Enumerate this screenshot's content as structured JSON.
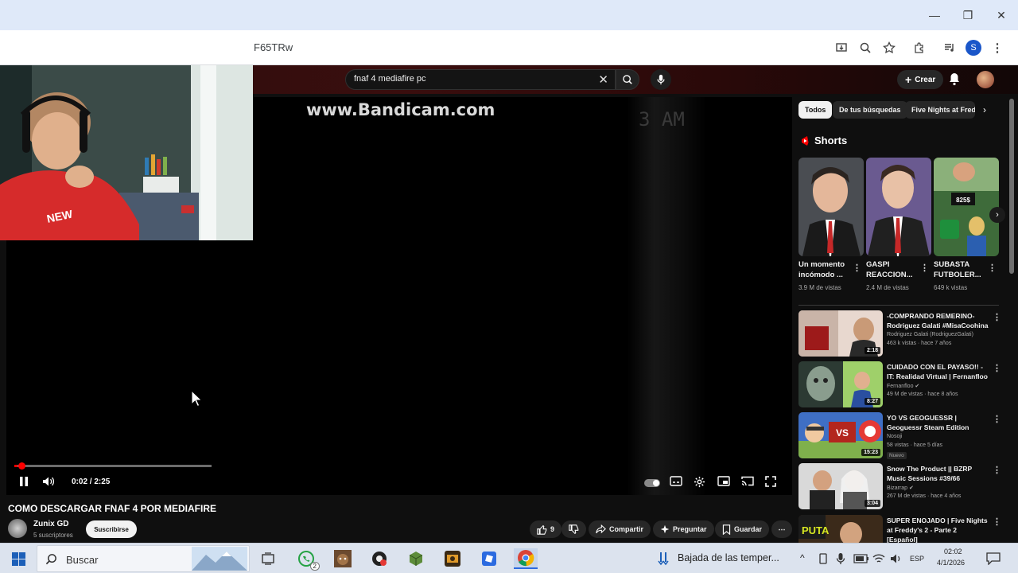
{
  "browser": {
    "url_fragment": "F65TRw",
    "window_controls": {
      "minimize": "—",
      "restore": "❐",
      "close": "✕"
    },
    "profile_initial": "S"
  },
  "youtube": {
    "search_query": "fnaf 4 mediafire pc",
    "create_label": "Crear",
    "player": {
      "watermark": "www.Bandicam.com",
      "scene_clock": "3 AM",
      "time": "0:02 / 2:25",
      "played_fraction": 0.015,
      "buffered_fraction": 0.11
    },
    "video": {
      "title": "COMO DESCARGAR FNAF 4 POR MEDIAFIRE",
      "channel": "Zunix GD",
      "subscribers": "5 suscriptores",
      "subscribe_label": "Suscribirse",
      "likes": "9",
      "share_label": "Compartir",
      "ask_label": "Preguntar",
      "save_label": "Guardar"
    },
    "chips": [
      "Todos",
      "De tus búsquedas",
      "Five Nights at Fred"
    ],
    "shorts_heading": "Shorts",
    "shorts": [
      {
        "title": "Un momento incómodo ...",
        "views": "3.9 M de vistas"
      },
      {
        "title": "GASPI REACCION...",
        "views": "2.4 M de vistas"
      },
      {
        "title": "SUBASTA FUTBOLER...",
        "views": "649 k vistas"
      }
    ],
    "recommended": [
      {
        "title": "-COMPRANDO REMERINO- Rodriguez Galati #MisaCoohina",
        "channel": "Rodriguez Galati (RodriguezGalati)",
        "meta": "463 k vistas · hace 7 años",
        "duration": "2:18",
        "badge": ""
      },
      {
        "title": "CUIDADO CON EL PAYASO!! - IT: Realidad Virtual | Fernanfloo",
        "channel": "Fernanfloo ✔",
        "meta": "49 M de vistas · hace 8 años",
        "duration": "8:27",
        "badge": ""
      },
      {
        "title": "YO VS GEOGUESSR | Geoguessr Steam Edition",
        "channel": "Nosoji",
        "meta": "58 vistas · hace 5 días",
        "duration": "15:23",
        "badge": "Nuevo"
      },
      {
        "title": "Snow The Product || BZRP Music Sessions #39/66",
        "channel": "Bizarrap ✔",
        "meta": "267 M de vistas · hace 4 años",
        "duration": "3:04",
        "badge": ""
      },
      {
        "title": "SUPER ENOJADO | Five Nights at Freddy's 2 - Parte 2 [Español]",
        "channel": "",
        "meta": "",
        "duration": "",
        "badge": ""
      }
    ]
  },
  "taskbar": {
    "search_placeholder": "Buscar",
    "weather_text": "Bajada de las temper...",
    "language": "ESP",
    "time": "02:02",
    "date": "4/1/2026",
    "whatsapp_badge": "2"
  }
}
